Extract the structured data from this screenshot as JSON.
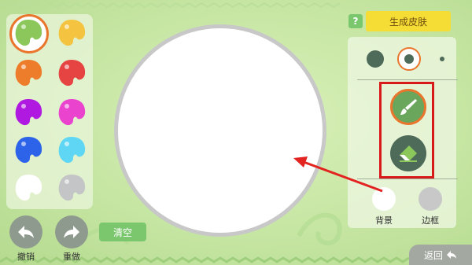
{
  "palette": {
    "colors": [
      "#8bc75a",
      "#f4c440",
      "#ee7d2b",
      "#e54442",
      "#b019e0",
      "#ea43ce",
      "#2c63e9",
      "#5fd7f4",
      "#ffffff",
      "#c4c5c6"
    ],
    "selected_index": 0
  },
  "actions": {
    "undo_label": "撤销",
    "redo_label": "重做",
    "clear_label": "清空"
  },
  "header": {
    "help_label": "?",
    "generate_label": "生成皮肤"
  },
  "tools": {
    "brush_sizes": [
      "large",
      "medium",
      "small"
    ],
    "selected_size": "medium",
    "brush_icon": "brush-icon",
    "eraser_icon": "eraser-icon",
    "selected_tool": "brush",
    "background_label": "背景",
    "border_label": "边框",
    "background_color": "#ffffff",
    "border_color": "#c7c8c7"
  },
  "footer": {
    "back_label": "返回"
  },
  "annotation": {
    "highlight_color": "#d81a1a"
  }
}
